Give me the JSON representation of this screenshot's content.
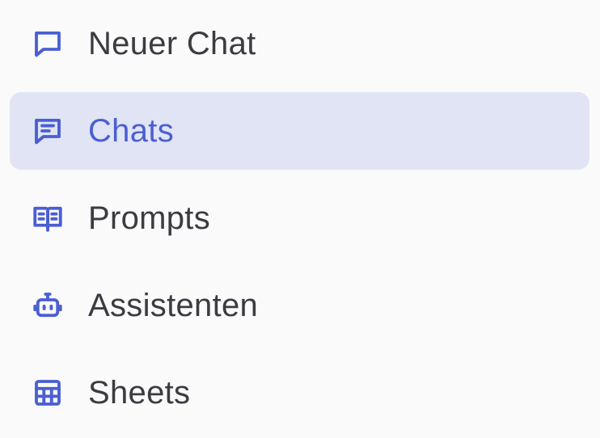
{
  "sidebar": {
    "accent_color": "#4a5fd3",
    "active_background": "#e1e4f4",
    "items": [
      {
        "label": "Neuer Chat",
        "icon": "chat-bubble-icon",
        "active": false
      },
      {
        "label": "Chats",
        "icon": "chat-lines-icon",
        "active": true
      },
      {
        "label": "Prompts",
        "icon": "book-icon",
        "active": false
      },
      {
        "label": "Assistenten",
        "icon": "robot-icon",
        "active": false
      },
      {
        "label": "Sheets",
        "icon": "table-icon",
        "active": false
      }
    ]
  }
}
